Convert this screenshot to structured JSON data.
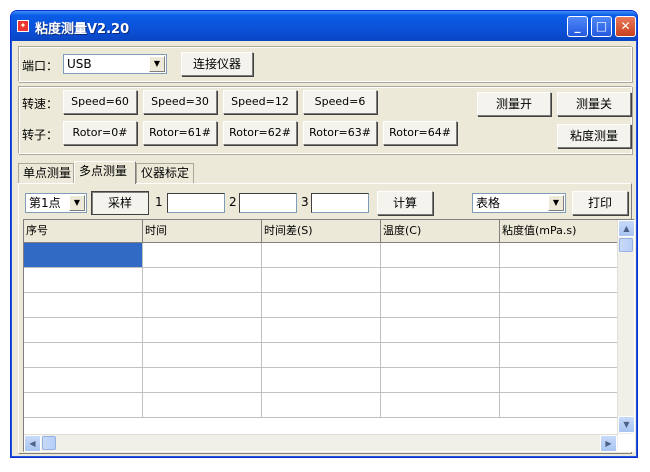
{
  "window": {
    "title": "粘度测量V2.20",
    "icon": "app-icon",
    "controls": [
      "minimize",
      "maximize",
      "close"
    ]
  },
  "port": {
    "label": "端口：",
    "value": "USB",
    "connect_label": "连接仪器"
  },
  "speed": {
    "label": "转速：",
    "buttons": [
      "Speed=60",
      "Speed=30",
      "Speed=12",
      "Speed=6"
    ]
  },
  "rotor": {
    "label": "转子：",
    "buttons": [
      "Rotor=0#",
      "Rotor=61#",
      "Rotor=62#",
      "Rotor=63#",
      "Rotor=64#"
    ]
  },
  "measure": {
    "on_label": "测量开",
    "off_label": "测量关",
    "viscosity_label": "粘度测量"
  },
  "tabs": [
    {
      "label": "单点测量",
      "active": false
    },
    {
      "label": "多点测量",
      "active": true
    },
    {
      "label": "仪器标定",
      "active": false
    }
  ],
  "multipoint": {
    "point_value": "第1点",
    "sample_label": "采样",
    "field1_label": "1",
    "field2_label": "2",
    "field3_label": "3",
    "compute_label": "计算",
    "format_value": "表格",
    "print_label": "打印"
  },
  "table": {
    "columns": [
      "序号",
      "时间",
      "时间差(S)",
      "温度(C)",
      "粘度值(mPa.s)"
    ],
    "row_count": 7,
    "selected_row": 0
  },
  "colors": {
    "selection": "#316ac5",
    "titlebar": "#0b52d8",
    "face": "#ece9d8"
  }
}
